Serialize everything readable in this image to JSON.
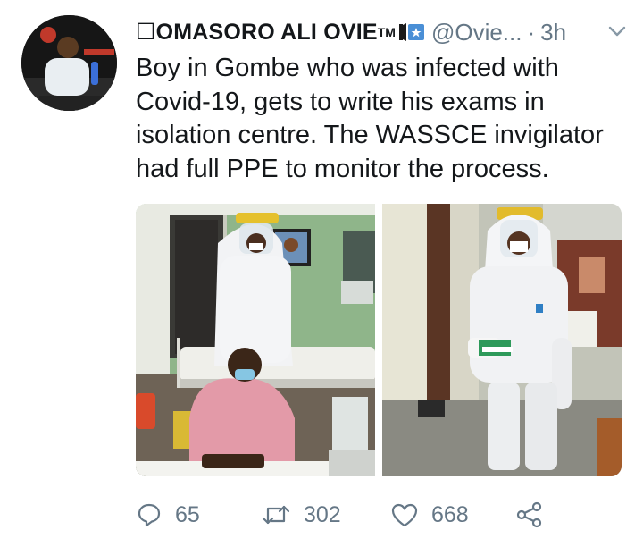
{
  "tweet": {
    "display_name": "☐OMASORO ALI OVIE",
    "tm": "TM",
    "handle": "@Ovie...",
    "separator": "·",
    "time": "3h",
    "text": "Boy in Gombe who was infected with Covid-19, gets to write his exams in isolation centre. The WASSCE invigilator had full PPE to monitor the process."
  },
  "actions": {
    "replies": "65",
    "retweets": "302",
    "likes": "668"
  },
  "icons": {
    "reply": "reply-icon",
    "retweet": "retweet-icon",
    "like": "heart-icon",
    "share": "share-icon",
    "more": "chevron-down-icon"
  },
  "colors": {
    "text": "#14171a",
    "muted": "#657786"
  }
}
